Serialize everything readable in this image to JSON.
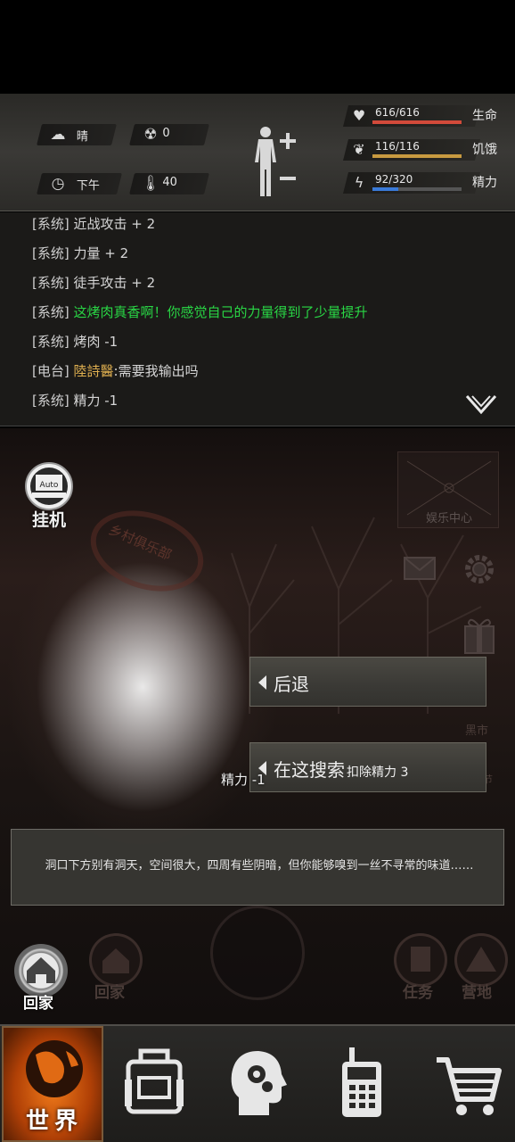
{
  "status": {
    "weather": "晴",
    "radiation": "0",
    "time_of_day": "下午",
    "temperature": "40"
  },
  "vitals": [
    {
      "value": "616/616",
      "label": "生命",
      "fraction": 1.0,
      "color": "#d24a3a",
      "icon": "heart-icon"
    },
    {
      "value": "116/116",
      "label": "饥饿",
      "fraction": 1.0,
      "color": "#c89a40",
      "icon": "stomach-icon"
    },
    {
      "value": "92/320",
      "label": "精力",
      "fraction": 0.2875,
      "color": "#3a7ad8",
      "icon": "energy-icon"
    }
  ],
  "log": [
    {
      "tag": "[系统]",
      "msg": "近战攻击 + 2"
    },
    {
      "tag": "[系统]",
      "msg": "力量 + 2"
    },
    {
      "tag": "[系统]",
      "msg": "徒手攻击 + 2"
    },
    {
      "tag": "[系统]",
      "msg": "这烤肉真香啊！你感觉自己的力量得到了少量提升"
    },
    {
      "tag": "[系统]",
      "msg": "烤肉 -1"
    },
    {
      "tag": "[电台]",
      "name": "陸詩醫",
      "msg": ":需要我输出吗"
    },
    {
      "tag": "[系统]",
      "msg": "精力 -1"
    }
  ],
  "scene": {
    "sign_text": "乡村俱乐部",
    "entertainment_label": "娱乐中心",
    "market_label": "黑市",
    "festival_label": "中秋节",
    "auto_label": "挂机",
    "auto_icon_text": "Auto"
  },
  "actions": {
    "retreat": "后退",
    "search": "在这搜索",
    "search_cost": "扣除精力 3"
  },
  "float_text": "精力 -1",
  "narration": "洞口下方别有洞天，空间很大，四周有些阴暗，但你能够嗅到一丝不寻常的味道……",
  "bottom": {
    "home": "回家",
    "home_ghost": "回家",
    "task": "任务",
    "camp": "营地"
  },
  "nav": {
    "world": "世界",
    "items": [
      "backpack-icon",
      "head-gears-icon",
      "walkie-talkie-icon",
      "shopping-cart-icon"
    ]
  }
}
